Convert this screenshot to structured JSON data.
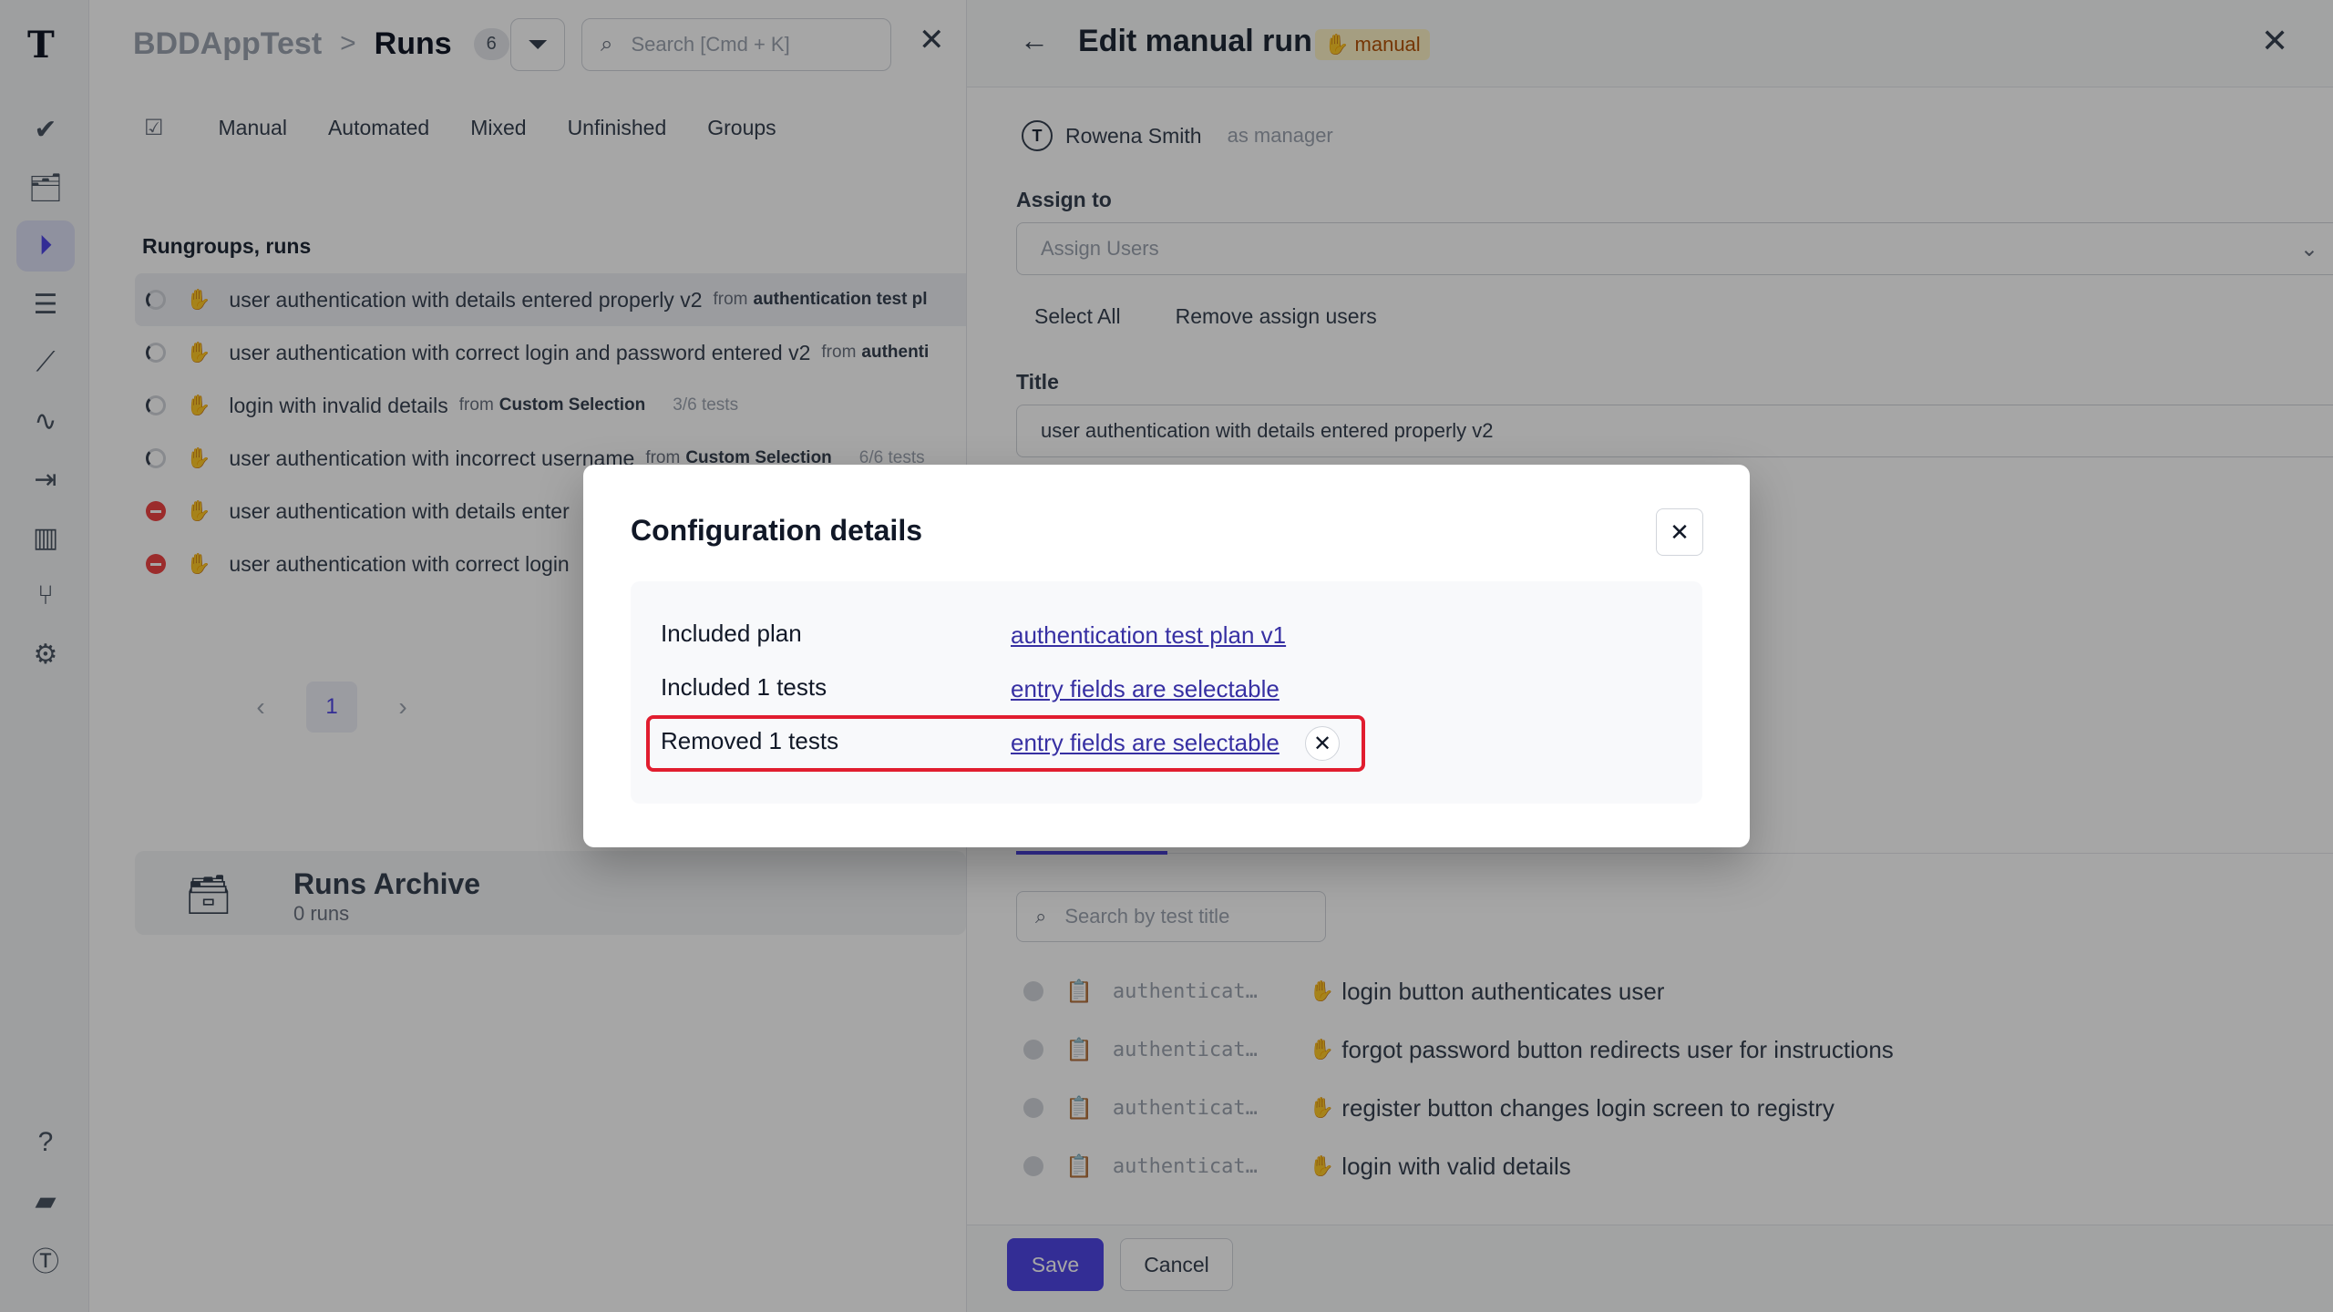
{
  "sidebar": {
    "logo": "T",
    "icons": [
      "check-icon",
      "briefcase-check-icon",
      "play-circle-icon",
      "list-check-icon",
      "steps-icon",
      "pulse-icon",
      "import-icon",
      "bar-chart-icon",
      "branch-icon",
      "gear-icon",
      "help-icon",
      "folders-icon",
      "avatar-logo-icon"
    ]
  },
  "runs": {
    "project": "BDDAppTest",
    "separator": ">",
    "title": "Runs",
    "count": "6",
    "search_placeholder": "Search [Cmd + K]",
    "tabs": [
      "Manual",
      "Automated",
      "Mixed",
      "Unfinished",
      "Groups"
    ],
    "section_title": "Rungroups, runs",
    "rows": [
      {
        "status": "pending",
        "title": "user authentication with details entered properly v2",
        "from": "from",
        "plan": "authentication test pl",
        "tests": ""
      },
      {
        "status": "pending",
        "title": "user authentication with correct login and password entered v2",
        "from": "from",
        "plan": "authenti",
        "tests": ""
      },
      {
        "status": "pending",
        "title": "login with invalid details",
        "from": "from",
        "plan": "Custom Selection",
        "tests": "3/6 tests"
      },
      {
        "status": "pending",
        "title": "user authentication with incorrect username",
        "from": "from",
        "plan": "Custom Selection",
        "tests": "6/6 tests"
      },
      {
        "status": "failed",
        "title": "user authentication with details enter",
        "from": "",
        "plan": "",
        "tests": ""
      },
      {
        "status": "failed",
        "title": "user authentication with correct login",
        "from": "",
        "plan": "",
        "tests": ""
      }
    ],
    "pager": {
      "prev": "‹",
      "page": "1",
      "next": "›"
    },
    "archive": {
      "title": "Runs Archive",
      "count": "0 runs"
    }
  },
  "edit": {
    "title": "Edit manual run",
    "badge": "manual",
    "manager_initial": "T",
    "manager_name": "Rowena Smith",
    "manager_role": "as manager",
    "assign_label": "Assign to",
    "assign_placeholder": "Assign Users",
    "select_all": "Select All",
    "remove_assign": "Remove assign users",
    "title_label": "Title",
    "title_value": "user authentication with details entered properly v2",
    "test_search_placeholder": "Search by test title",
    "tests": [
      {
        "suite": "authenticat…",
        "title": "login button authenticates user"
      },
      {
        "suite": "authenticat…",
        "title": "forgot password button redirects user for instructions"
      },
      {
        "suite": "authenticat…",
        "title": "register button changes login screen to registry"
      },
      {
        "suite": "authenticat…",
        "title": "login with valid details"
      }
    ],
    "save": "Save",
    "cancel": "Cancel"
  },
  "modal": {
    "title": "Configuration details",
    "rows": [
      {
        "label": "Included plan",
        "link": "authentication test plan v1"
      },
      {
        "label": "Included 1 tests",
        "link": "entry fields are selectable"
      },
      {
        "label": "Removed 1 tests",
        "link": "entry fields are selectable"
      }
    ]
  },
  "colors": {
    "accent": "#4f46e5",
    "highlight": "#e11d2f",
    "failed": "#ef4444",
    "manual": "#d97706"
  }
}
